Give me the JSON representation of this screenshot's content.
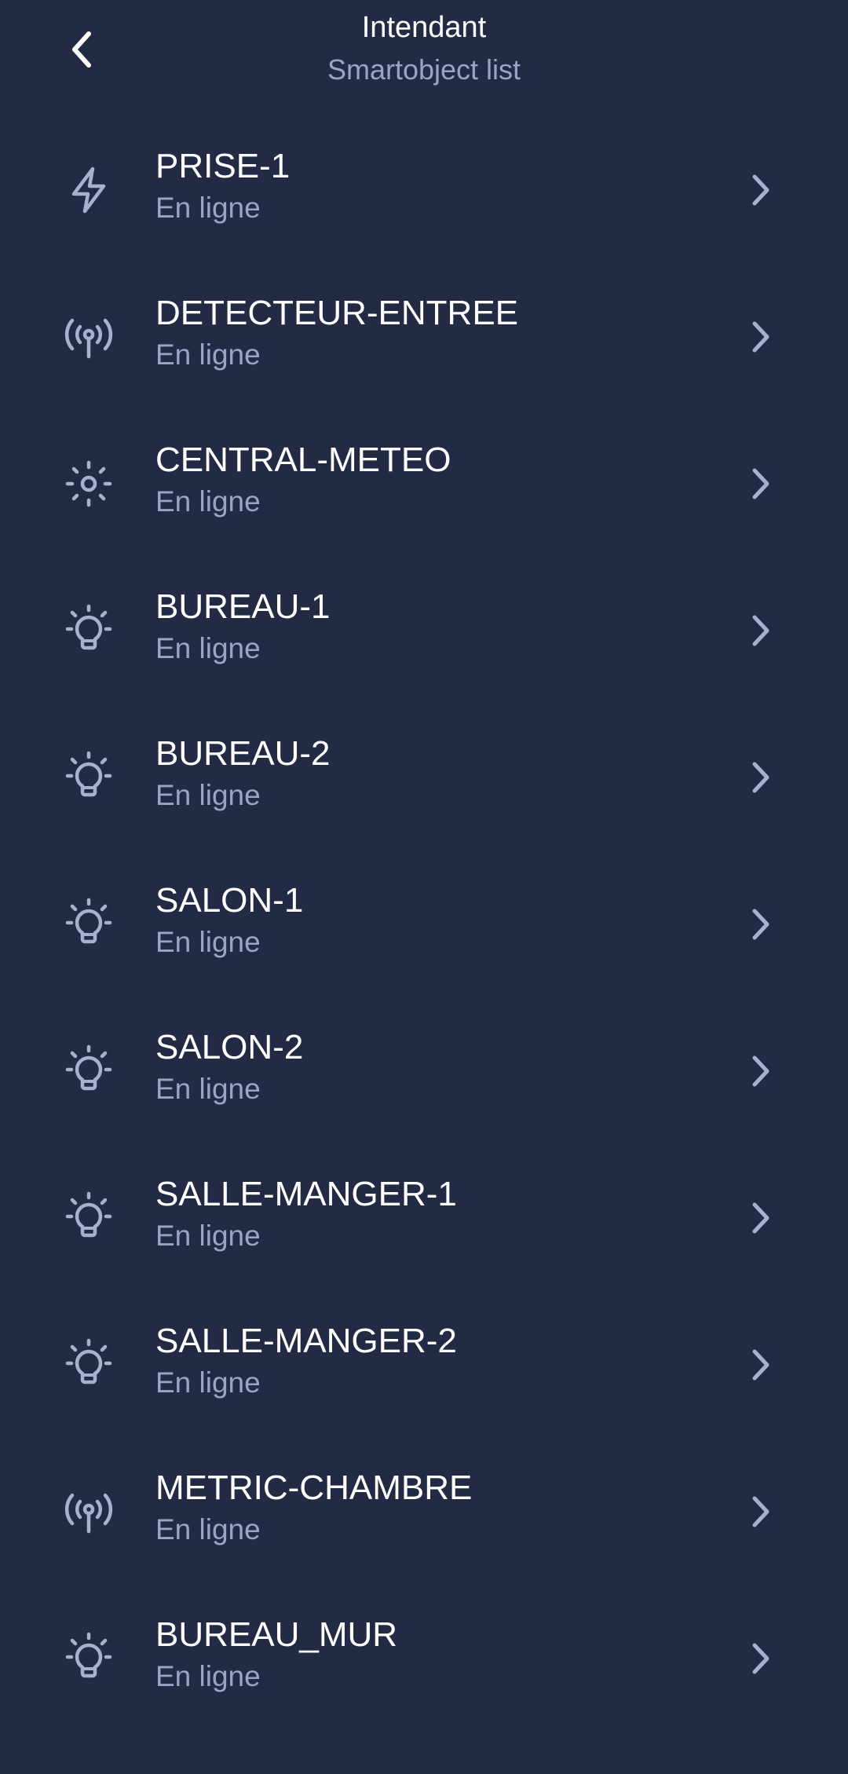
{
  "header": {
    "title": "Intendant",
    "subtitle": "Smartobject list",
    "back_icon": "chevron-left-icon"
  },
  "items": [
    {
      "name": "PRISE-1",
      "status": "En ligne",
      "icon": "bolt"
    },
    {
      "name": "DETECTEUR-ENTREE",
      "status": "En ligne",
      "icon": "antenna"
    },
    {
      "name": "CENTRAL-METEO",
      "status": "En ligne",
      "icon": "sun"
    },
    {
      "name": "BUREAU-1",
      "status": "En ligne",
      "icon": "bulb"
    },
    {
      "name": "BUREAU-2",
      "status": "En ligne",
      "icon": "bulb"
    },
    {
      "name": "SALON-1",
      "status": "En ligne",
      "icon": "bulb"
    },
    {
      "name": "SALON-2",
      "status": "En ligne",
      "icon": "bulb"
    },
    {
      "name": "SALLE-MANGER-1",
      "status": "En ligne",
      "icon": "bulb"
    },
    {
      "name": "SALLE-MANGER-2",
      "status": "En ligne",
      "icon": "bulb"
    },
    {
      "name": "METRIC-CHAMBRE",
      "status": "En ligne",
      "icon": "antenna"
    },
    {
      "name": "BUREAU_MUR",
      "status": "En ligne",
      "icon": "bulb"
    }
  ],
  "colors": {
    "background": "#222a44",
    "primary_text": "#ffffff",
    "secondary_text": "#9aa4c4",
    "icon": "#a7b0cc"
  }
}
